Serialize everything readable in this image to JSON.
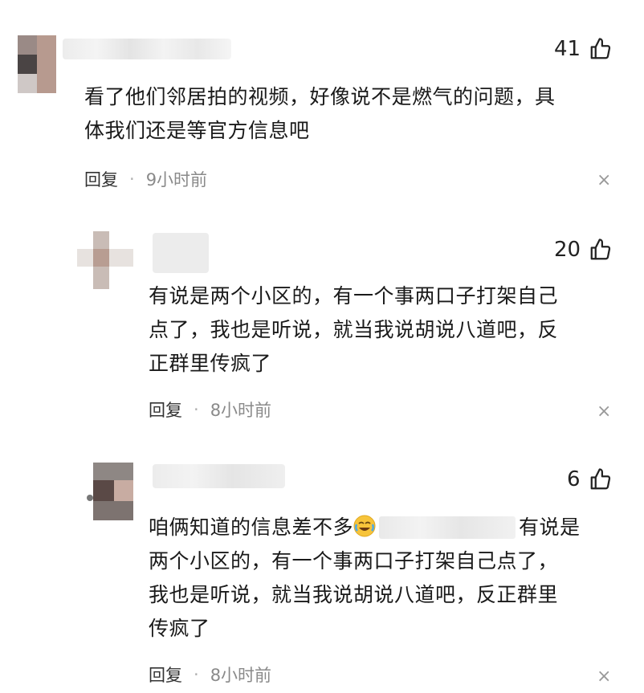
{
  "comments": [
    {
      "likes": "41",
      "text_lines": [
        "看了他们邻居拍的视频，好像说不是燃气的问题，具",
        "体我们还是等官方信息吧"
      ],
      "reply_label": "回复",
      "separator": "·",
      "time": "9小时前",
      "close": "×"
    },
    {
      "likes": "20",
      "text_lines": [
        "有说是两个小区的，有一个事两口子打架自己",
        "点了，我也是听说，就当我说胡说八道吧，反",
        "正群里传疯了"
      ],
      "reply_label": "回复",
      "separator": "·",
      "time": "8小时前",
      "close": "×"
    },
    {
      "likes": "6",
      "line1_before": "咱俩知道的信息差不多",
      "line1_after": "有说是",
      "text_lines_rest": [
        "两个小区的，有一个事两口子打架自己点了，",
        "我也是听说，就当我说胡说八道吧，反正群里",
        "传疯了"
      ],
      "reply_label": "回复",
      "separator": "·",
      "time": "8小时前",
      "close": "×"
    }
  ],
  "icons": {
    "like": "thumbs-up-icon",
    "close": "close-icon",
    "emoji": "crying-laughing-emoji-icon"
  },
  "colors": {
    "text": "#1a1a1a",
    "meta_time": "#8a8a8a",
    "blur": "#e8e8e8"
  }
}
